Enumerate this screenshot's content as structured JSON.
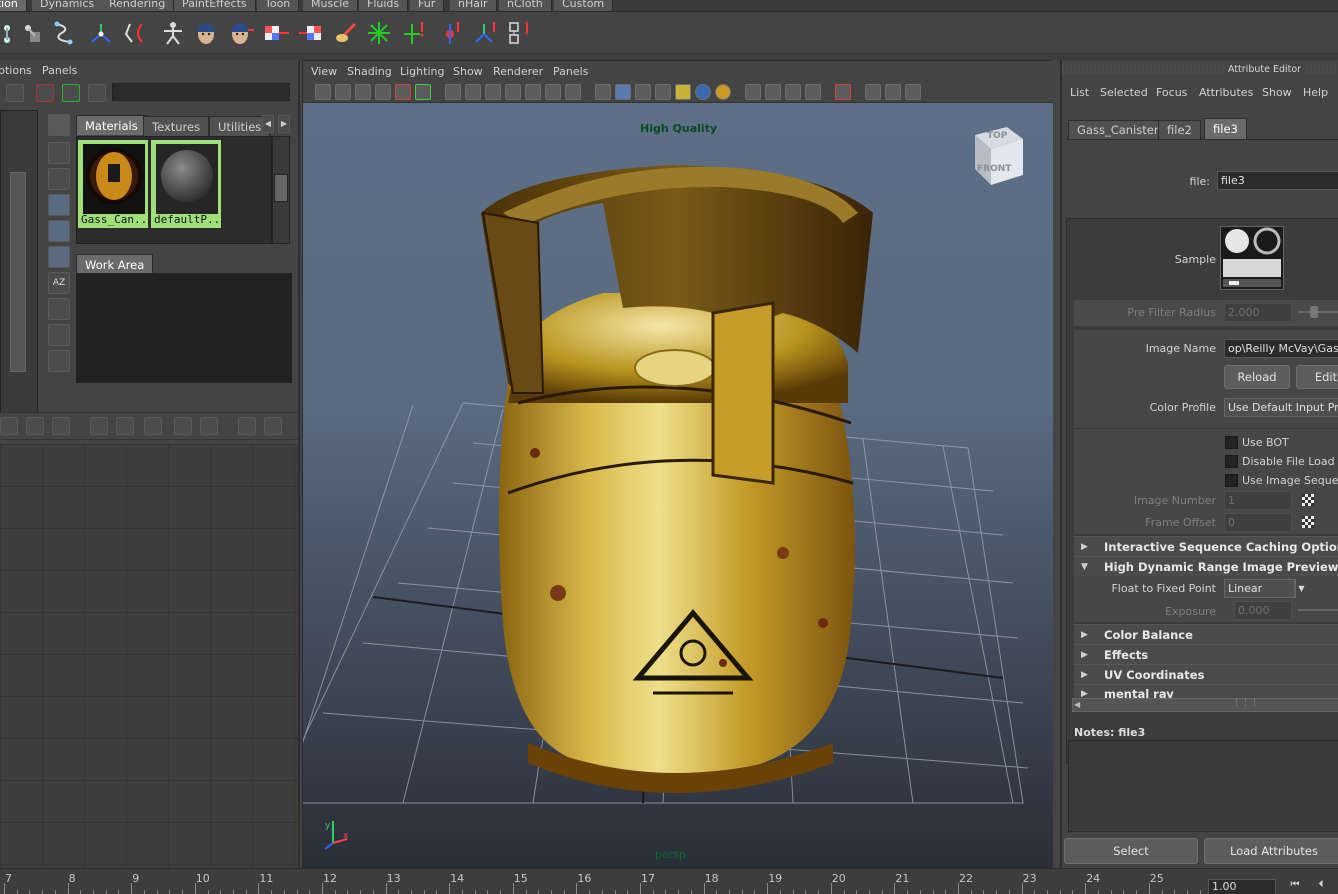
{
  "shelf": {
    "tabs": [
      {
        "label": "ation",
        "active": true
      },
      {
        "label": "Dynamics"
      },
      {
        "label": "Rendering"
      },
      {
        "label": "PaintEffects"
      },
      {
        "label": "Toon"
      },
      {
        "label": "Muscle"
      },
      {
        "label": "Fluids"
      },
      {
        "label": "Fur"
      },
      {
        "label": "nHair"
      },
      {
        "label": "nCloth"
      },
      {
        "label": "Custom"
      }
    ]
  },
  "hypershade": {
    "menu": [
      "ptions",
      "Panels"
    ],
    "tabs": [
      "Materials",
      "Textures",
      "Utilities"
    ],
    "swatches": [
      "Gass_Can...",
      "defaultP..."
    ],
    "work_area_label": "Work Area"
  },
  "viewport": {
    "menu": [
      "View",
      "Shading",
      "Lighting",
      "Show",
      "Renderer",
      "Panels"
    ],
    "hq_label": "High Quality",
    "view_cube_top": "TOP",
    "view_cube_front": "FRONT",
    "camera_label": "persp",
    "axis_y": "y",
    "axis_x": "x"
  },
  "attribute_editor": {
    "title": "Attribute Editor",
    "menu": [
      "List",
      "Selected",
      "Focus",
      "Attributes",
      "Show",
      "Help"
    ],
    "tabs": [
      "Gass_Canister",
      "file2",
      "file3"
    ],
    "active_tab": "file3",
    "file_label": "file:",
    "file_value": "file3",
    "sample_label": "Sample",
    "pre_filter_label": "Pre Filter Radius",
    "pre_filter_value": "2.000",
    "image_name_label": "Image Name",
    "image_name_value": "op\\Reilly McVay\\GasCan",
    "reload_label": "Reload",
    "edit_label": "Edit",
    "color_profile_label": "Color Profile",
    "color_profile_value": "Use Default Input Profi",
    "use_bot_label": "Use BOT",
    "disable_file_load_label": "Disable File Load",
    "use_image_sequence_label": "Use Image Sequence",
    "image_number_label": "Image Number",
    "image_number_value": "1",
    "frame_offset_label": "Frame Offset",
    "frame_offset_value": "0",
    "sections": {
      "interactive": "Interactive Sequence Caching Options",
      "hdr": "High Dynamic Range Image Preview Optio",
      "color_balance": "Color Balance",
      "effects": "Effects",
      "uv": "UV Coordinates",
      "mental_ray": "mental ray"
    },
    "float_to_fixed_label": "Float to Fixed Point",
    "float_to_fixed_value": "Linear",
    "exposure_label": "Exposure",
    "exposure_value": "0.000",
    "notes_label": "Notes:  file3",
    "select_label": "Select",
    "load_attributes_label": "Load Attributes"
  },
  "timeline": {
    "ticks": [
      "7",
      "8",
      "9",
      "10",
      "11",
      "12",
      "13",
      "14",
      "15",
      "16",
      "17",
      "18",
      "19",
      "20",
      "21",
      "22",
      "23",
      "24",
      "25"
    ],
    "frame_value": "1.00"
  }
}
